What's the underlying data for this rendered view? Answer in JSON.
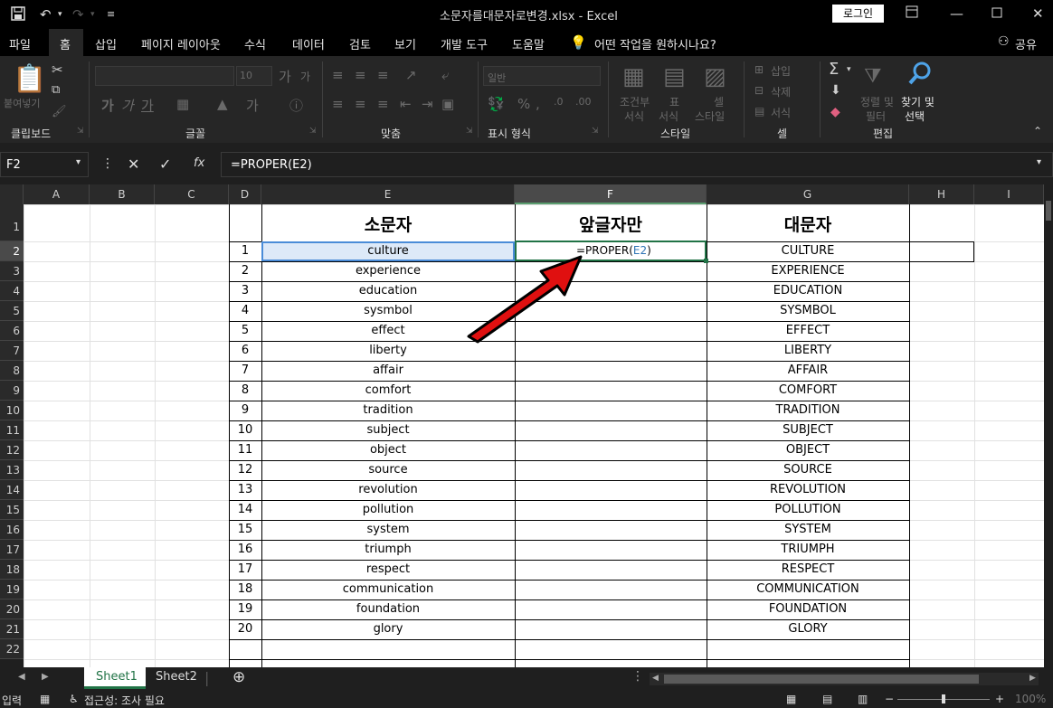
{
  "titlebar": {
    "save_icon": "save-icon",
    "undo_icon": "undo-icon",
    "redo_icon": "redo-icon",
    "title": "소문자를대문자로변경.xlsx  -  Excel",
    "login": "로그인"
  },
  "menu": {
    "tabs": [
      "파일",
      "홈",
      "삽입",
      "페이지 레이아웃",
      "수식",
      "데이터",
      "검토",
      "보기",
      "개발 도구",
      "도움말"
    ],
    "tell_me": "어떤 작업을 원하시나요?",
    "share": "공유"
  },
  "ribbon": {
    "groups": {
      "clipboard": "클립보드",
      "font": "글꼴",
      "alignment": "맞춤",
      "number": "표시 형식",
      "styles": "스타일",
      "cells": "셀",
      "editing": "편집"
    },
    "paste": "붙여넣기",
    "font_size": "10",
    "number_format": "일반",
    "conditional_format_1": "조건부",
    "conditional_format_2": "서식",
    "format_table_1": "표",
    "format_table_2": "서식",
    "cell_styles_1": "셀",
    "cell_styles_2": "스타일",
    "insert": "삽입",
    "delete": "삭제",
    "format": "서식",
    "sort_filter_1": "정렬 및",
    "sort_filter_2": "필터",
    "find_select_1": "찾기 및",
    "find_select_2": "선택"
  },
  "formula_bar": {
    "name_box": "F2",
    "formula": "=PROPER(E2)"
  },
  "columns": [
    "A",
    "B",
    "C",
    "D",
    "E",
    "F",
    "G",
    "H",
    "I"
  ],
  "sheet": {
    "headers": {
      "E": "소문자",
      "F": "앞글자만",
      "G": "대문자"
    },
    "edit_formula_prefix": "=PROPER(",
    "edit_formula_ref": "E2",
    "edit_formula_suffix": ")",
    "rows": [
      {
        "n": "1",
        "lower": "culture",
        "upper": "CULTURE"
      },
      {
        "n": "2",
        "lower": "experience",
        "upper": "EXPERIENCE"
      },
      {
        "n": "3",
        "lower": "education",
        "upper": "EDUCATION"
      },
      {
        "n": "4",
        "lower": "sysmbol",
        "upper": "SYSMBOL"
      },
      {
        "n": "5",
        "lower": "effect",
        "upper": "EFFECT"
      },
      {
        "n": "6",
        "lower": "liberty",
        "upper": "LIBERTY"
      },
      {
        "n": "7",
        "lower": "affair",
        "upper": "AFFAIR"
      },
      {
        "n": "8",
        "lower": "comfort",
        "upper": "COMFORT"
      },
      {
        "n": "9",
        "lower": "tradition",
        "upper": "TRADITION"
      },
      {
        "n": "10",
        "lower": "subject",
        "upper": "SUBJECT"
      },
      {
        "n": "11",
        "lower": "object",
        "upper": "OBJECT"
      },
      {
        "n": "12",
        "lower": "source",
        "upper": "SOURCE"
      },
      {
        "n": "13",
        "lower": "revolution",
        "upper": "REVOLUTION"
      },
      {
        "n": "14",
        "lower": "pollution",
        "upper": "POLLUTION"
      },
      {
        "n": "15",
        "lower": "system",
        "upper": "SYSTEM"
      },
      {
        "n": "16",
        "lower": "triumph",
        "upper": "TRIUMPH"
      },
      {
        "n": "17",
        "lower": "respect",
        "upper": "RESPECT"
      },
      {
        "n": "18",
        "lower": "communication",
        "upper": "COMMUNICATION"
      },
      {
        "n": "19",
        "lower": "foundation",
        "upper": "FOUNDATION"
      },
      {
        "n": "20",
        "lower": "glory",
        "upper": "GLORY"
      }
    ]
  },
  "row_numbers": [
    "1",
    "2",
    "3",
    "4",
    "5",
    "6",
    "7",
    "8",
    "9",
    "10",
    "11",
    "12",
    "13",
    "14",
    "15",
    "16",
    "17",
    "18",
    "19",
    "20",
    "21",
    "22"
  ],
  "sheets": [
    "Sheet1",
    "Sheet2"
  ],
  "status": {
    "mode": "입력",
    "accessibility": "접근성: 조사 필요",
    "zoom": "100%"
  },
  "colors": {
    "accent_green": "#217346",
    "arrow_red": "#e01010",
    "ref_blue": "#2f75b5"
  }
}
